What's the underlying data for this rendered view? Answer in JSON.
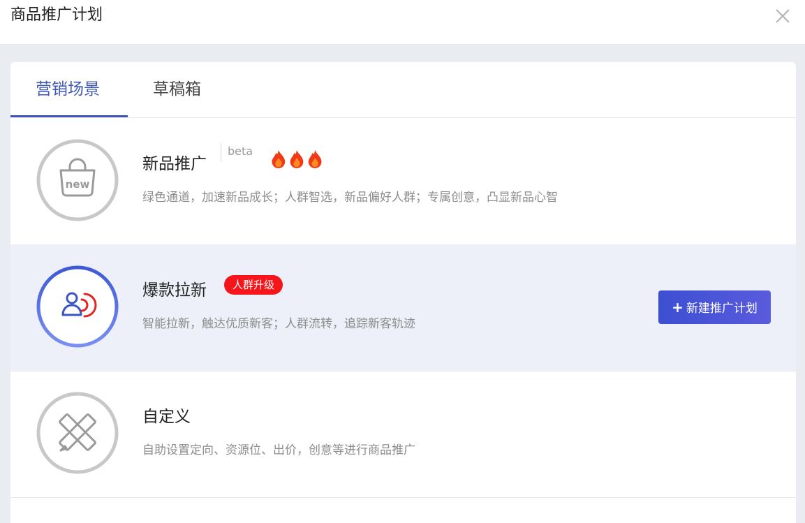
{
  "header": {
    "title": "商品推广计划"
  },
  "tabs": [
    {
      "label": "营销场景",
      "active": true
    },
    {
      "label": "草稿箱",
      "active": false
    }
  ],
  "scenes": [
    {
      "name": "新品推广",
      "tag": "beta",
      "hot_level": 3,
      "description": "绿色通道，加速新品成长；人群智选，新品偏好人群；专属创意，凸显新品心智",
      "icon": "new-bag-icon",
      "icon_text": "new"
    },
    {
      "name": "爆款拉新",
      "badge": "人群升级",
      "description": "智能拉新，触达优质新客；人群流转，追踪新客轨迹",
      "icon": "user-signal-icon",
      "button_label": "新建推广计划",
      "button_plus": "+"
    },
    {
      "name": "自定义",
      "description": "自助设置定向、资源位、出价，创意等进行商品推广",
      "icon": "pencil-ruler-icon"
    }
  ],
  "colors": {
    "accent": "#3e57b6",
    "badge_red": "#f5151b",
    "button_start": "#3c4fd2",
    "button_end": "#5a5bdd",
    "row_highlight": "#edf0f8"
  }
}
